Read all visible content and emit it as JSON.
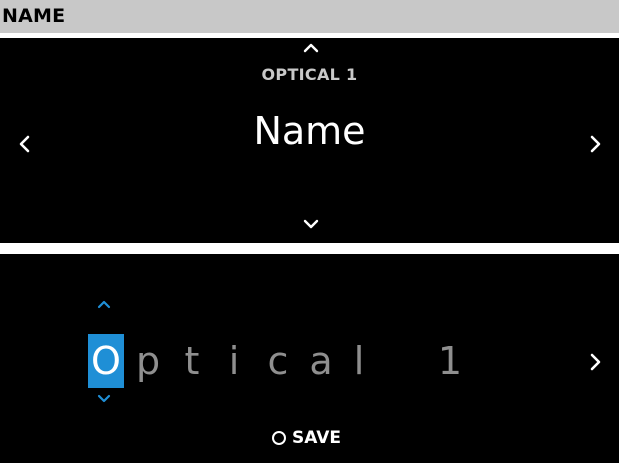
{
  "header": {
    "title": "NAME"
  },
  "menu_screen": {
    "category": "OPTICAL 1",
    "title": "Name",
    "icons": [
      "chevron-up-icon",
      "chevron-down-icon",
      "chevron-left-icon",
      "chevron-right-icon"
    ]
  },
  "edit_screen": {
    "characters": [
      "O",
      "p",
      "t",
      "i",
      "c",
      "a",
      "l",
      " ",
      "1"
    ],
    "selected_index": 0,
    "save_label": "SAVE",
    "icons": [
      "char-up-icon",
      "char-down-icon",
      "chevron-right-icon",
      "radio-circle-icon"
    ]
  },
  "colors": {
    "header_background": "#c8c8c8",
    "panel_background": "#000000",
    "selection_accent": "#1f8fd6",
    "unselected_char": "#8f8f8f"
  }
}
